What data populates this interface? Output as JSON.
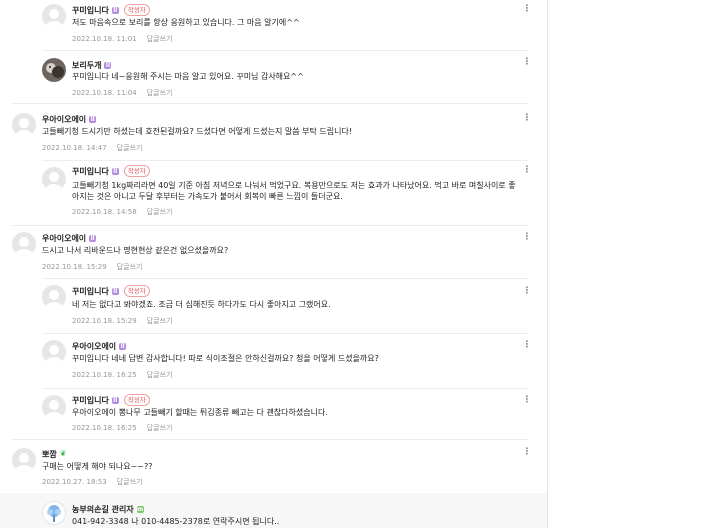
{
  "comments": [
    {
      "name": "꾸미입니다",
      "level": "lv-icon",
      "badge": "작성자",
      "text": "저도 마음속으로 보리를 항상 응원하고 있습니다. 그 마음 알기에^^",
      "date": "2022.10.18. 11:01",
      "reply": "답글쓰기"
    },
    {
      "name": "보리두개",
      "level": "lv-icon",
      "badge": "",
      "text": "꾸미입니다 네~응원해 주시는 마음 알고 있어요. 꾸미님 감사해요^^",
      "date": "2022.10.18. 11:04",
      "reply": "답글쓰기"
    },
    {
      "name": "우아이오에이",
      "level": "lv-icon",
      "badge": "",
      "text": "고들빼기청 드시기만 하셨는데 호전된걸까요? 드셨다면 어떻게 드셨는지 말씀 부탁 드립니다!",
      "date": "2022.10.18. 14:47",
      "reply": "답글쓰기"
    },
    {
      "name": "꾸미입니다",
      "level": "lv-icon",
      "badge": "작성자",
      "text": "고들빼기청 1kg짜리라면 40일 기준 아침 저녁으로 나눠서 먹었구요. 복용만으로도 저는 효과가 나타났어요. 먹고 바로 며칠사이로 좋아지는 것은 아니고 두달 후부터는 가속도가 붙어서 회복이 빠른 느낌이 들더군요.",
      "date": "2022.10.18. 14:58",
      "reply": "답글쓰기"
    },
    {
      "name": "우아이오에이",
      "level": "lv-icon",
      "badge": "",
      "text": "드시고 나서 리바운드나 명현현상 같은건 없으셨을까요?",
      "date": "2022.10.18. 15:29",
      "reply": "답글쓰기"
    },
    {
      "name": "꾸미입니다",
      "level": "lv-icon",
      "badge": "작성자",
      "text": "네 저는 없다고 봐야겠죠. 조금 더 심해진듯 하다가도 다시 좋아지고 그랬어요.",
      "date": "2022.10.18. 15:29",
      "reply": "답글쓰기"
    },
    {
      "name": "우아이오에이",
      "level": "lv-icon",
      "badge": "",
      "text": "꾸미입니다 네네 답변 감사합니다! 따로 식이조절은 안하신걸까요? 청을 어떻게 드셨을까요?",
      "date": "2022.10.18. 16:25",
      "reply": "답글쓰기"
    },
    {
      "name": "꾸미입니다",
      "level": "lv-icon",
      "badge": "작성자",
      "text": "우아이오에이 뽕나무 고들빼기 할때는 튀김종류 빼고는 다 괜찮다하셨습니다.",
      "date": "2022.10.18. 16:25",
      "reply": "답글쓰기"
    },
    {
      "name": "뽀깜",
      "level": "sprout-icon",
      "badge": "",
      "text": "구매는 어떻게 해야 되나요~~??",
      "date": "2022.10.27. 18:53",
      "reply": "답글쓰기"
    },
    {
      "name": "농부의손길 관리자",
      "level": "manager-icon",
      "badge": "",
      "text": "041-942-3348 나 010-4485-2378로 연락주시면 됩니다..",
      "date": "",
      "reply": ""
    }
  ],
  "icons": {
    "more": "kebab-icon",
    "default_avatar": "person-icon"
  },
  "colors": {
    "author_badge": "#e25a5a",
    "level_badge": "#b28ce0",
    "meta": "#979797",
    "highlight_bg": "#f7f7f7"
  }
}
